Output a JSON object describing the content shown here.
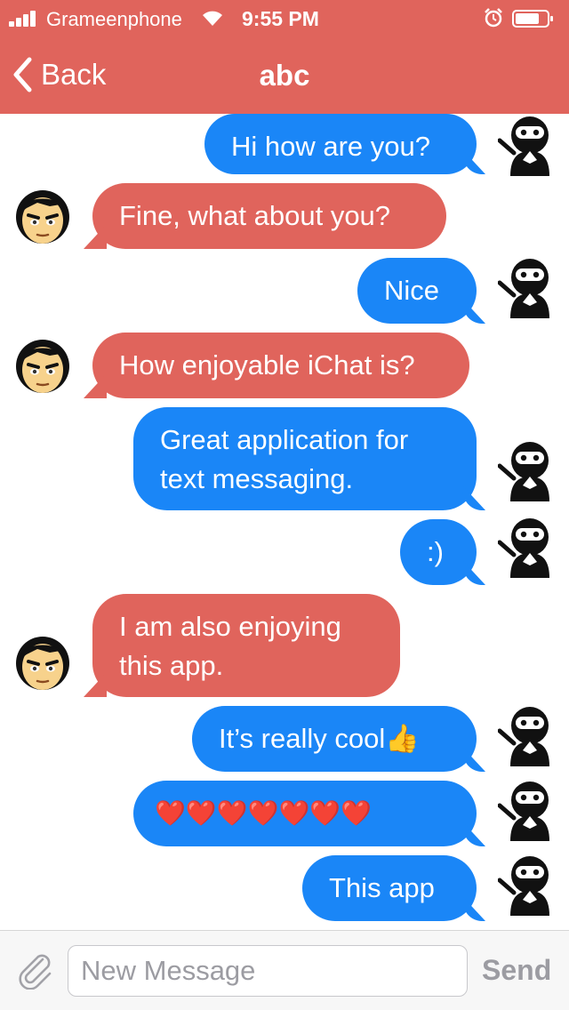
{
  "status_bar": {
    "carrier": "Grameenphone",
    "time": "9:55 PM",
    "icons": [
      "signal-icon",
      "wifi-icon",
      "alarm-icon",
      "battery-icon"
    ]
  },
  "nav": {
    "back_label": "Back",
    "title": "abc"
  },
  "messages": [
    {
      "direction": "sent",
      "text": "Hi how are you?",
      "avatar": "ninja-avatar-icon"
    },
    {
      "direction": "received",
      "text": "Fine, what about you?",
      "avatar": "boy-avatar-icon"
    },
    {
      "direction": "sent",
      "text": "Nice",
      "avatar": "ninja-avatar-icon"
    },
    {
      "direction": "received",
      "text": "How enjoyable iChat is?",
      "avatar": "boy-avatar-icon"
    },
    {
      "direction": "sent",
      "text_lines": [
        "Great application for",
        "text messaging."
      ],
      "avatar": "ninja-avatar-icon"
    },
    {
      "direction": "sent",
      "text": ":)",
      "avatar": "ninja-avatar-icon"
    },
    {
      "direction": "received",
      "text_lines": [
        "I am also enjoying",
        "this app."
      ],
      "avatar": "boy-avatar-icon"
    },
    {
      "direction": "sent",
      "text": "It’s really cool👍",
      "avatar": "ninja-avatar-icon"
    },
    {
      "direction": "sent",
      "text": "❤️❤️❤️❤️❤️❤️❤️",
      "avatar": "ninja-avatar-icon"
    },
    {
      "direction": "sent",
      "text": "This app",
      "avatar": "ninja-avatar-icon"
    }
  ],
  "composer": {
    "placeholder": "New Message",
    "value": "",
    "send_label": "Send",
    "attach_icon": "paperclip-icon"
  },
  "colors": {
    "header": "#e0645c",
    "sent_bubble": "#1a86f7",
    "received_bubble": "#e0645c",
    "send_disabled": "#9c9ca2"
  }
}
